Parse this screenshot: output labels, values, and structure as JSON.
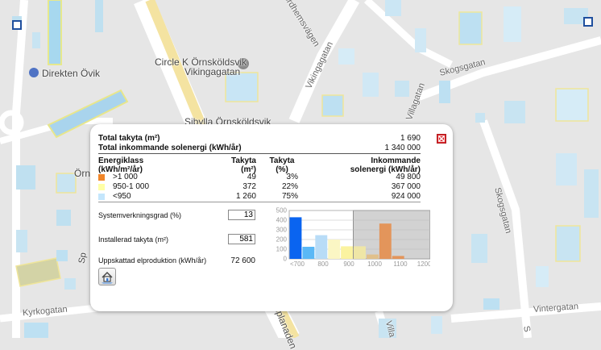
{
  "map": {
    "labels": {
      "circle_k_1": "Circle K Örnsköldsvik",
      "circle_k_2": "Vikingagatan",
      "direkten": "Direkten Övik",
      "sibylla": "Sibylla Örnsköldsvik",
      "orns": "Örns",
      "sp": "Sp"
    },
    "streets": {
      "nordhemsvagen": "ordhemsvägen",
      "vikingagatan": "Vikingagatan",
      "villagatan": "Villagatan",
      "skogsgatan_top": "Skogsgatan",
      "skogsgatan_side": "Skogsgatan",
      "vintergatan": "Vintergatan",
      "kyrkogatan": "Kyrkogatan",
      "esplanaden": "esplanaden",
      "villa_bottom": "Villa",
      "s_bottom": "S"
    }
  },
  "popup": {
    "close_label": "×",
    "summary": {
      "total_area_label": "Total takyta (m²)",
      "total_area_value": "1 690",
      "total_energy_label": "Total inkommande solenergi (kWh/år)",
      "total_energy_value": "1 340 000"
    },
    "table": {
      "headers": {
        "class_1": "Energiklass",
        "class_2": "(kWh/m²/år)",
        "area_1": "Takyta",
        "area_2": "(m²)",
        "pct_1": "Takyta",
        "pct_2": "(%)",
        "energy_1": "Inkommande",
        "energy_2": "solenergi (kWh/år)"
      },
      "rows": [
        {
          "label": ">1 000",
          "area": "49",
          "pct": "3%",
          "energy": "49 800",
          "color": "#f0862a"
        },
        {
          "label": "950-1 000",
          "area": "372",
          "pct": "22%",
          "energy": "367 000",
          "color": "#ffffa6"
        },
        {
          "label": "<950",
          "area": "1 260",
          "pct": "75%",
          "energy": "924 000",
          "color": "#c4e6fc"
        }
      ]
    },
    "inputs": {
      "efficiency_label": "Systemverkningsgrad (%)",
      "efficiency_value": "13",
      "installed_label": "Installerad takyta (m²)",
      "installed_value": "581",
      "production_label": "Uppskattad elproduktion (kWh/år)",
      "production_value": "72 600"
    },
    "house_button_icon": "house-icon"
  },
  "chart_data": {
    "type": "bar",
    "ylim": [
      0,
      500
    ],
    "yticks": [
      "500",
      "400",
      "300",
      "200",
      "100",
      "0"
    ],
    "xticks": [
      "<700",
      "800",
      "900",
      "1000",
      "1100",
      "1200+"
    ],
    "shaded_from": "900",
    "bars": [
      {
        "bin": "<700",
        "value": 430,
        "color": "#0a64f0"
      },
      {
        "bin": "700-750",
        "value": 125,
        "color": "#5ab8f6"
      },
      {
        "bin": "750-800",
        "value": 245,
        "color": "#b8dcf7"
      },
      {
        "bin": "800-850",
        "value": 200,
        "color": "#fbf6c4"
      },
      {
        "bin": "850-900",
        "value": 130,
        "color": "#fbf3a0"
      },
      {
        "bin": "900-950",
        "value": 130,
        "color": "#efe6a6"
      },
      {
        "bin": "950-1000",
        "value": 45,
        "color": "#e1c08b"
      },
      {
        "bin": "1000-1050",
        "value": 365,
        "color": "#e3955b"
      },
      {
        "bin": "1050-1100",
        "value": 30,
        "color": "#e3955b"
      },
      {
        "bin": "1100-1150",
        "value": 0,
        "color": "#e3955b"
      },
      {
        "bin": "1150-1200",
        "value": 0,
        "color": "#e3955b"
      }
    ]
  }
}
